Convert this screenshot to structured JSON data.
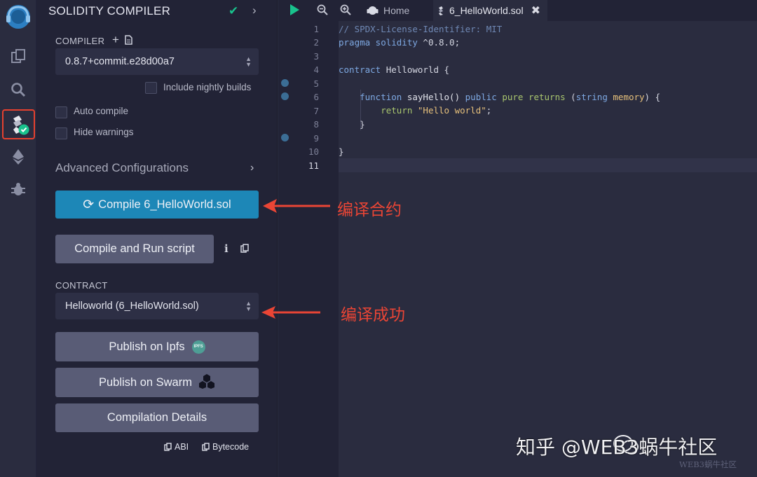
{
  "sidebar": {
    "title": "SOLIDITY COMPILER",
    "compiler_label": "COMPILER",
    "compiler_version": "0.8.7+commit.e28d00a7",
    "include_nightly": "Include nightly builds",
    "auto_compile": "Auto compile",
    "hide_warnings": "Hide warnings",
    "advanced": "Advanced Configurations",
    "compile_button": "Compile 6_HelloWorld.sol",
    "run_script_button": "Compile and Run script",
    "contract_label": "CONTRACT",
    "contract_value": "Helloworld (6_HelloWorld.sol)",
    "publish_ipfs": "Publish on Ipfs",
    "ipfs_badge": "IPFS",
    "publish_swarm": "Publish on Swarm",
    "compilation_details": "Compilation Details",
    "abi_link": "ABI",
    "bytecode_link": "Bytecode"
  },
  "tabs": {
    "home": "Home",
    "file": "6_HelloWorld.sol"
  },
  "editor": {
    "line_numbers": [
      "1",
      "2",
      "3",
      "4",
      "5",
      "6",
      "7",
      "8",
      "9",
      "10",
      "11"
    ],
    "active_line": "11",
    "line1": "// SPDX-License-Identifier: MIT",
    "line2_kw": "pragma solidity",
    "line2_rest": " ^0.8.0;",
    "line4_kw": "contract",
    "line4_rest": " Helloworld {",
    "line6_kw1": "function",
    "line6_name": " sayHello() ",
    "line6_kw2": "public",
    "line6_pure": "pure returns",
    "line6_open": " (",
    "line6_type": "string",
    "line6_mem": "memory",
    "line6_close": ") {",
    "line7_kw": "return",
    "line7_str": "\"Hello world\"",
    "line7_end": ";",
    "line8": "}",
    "line10": "}"
  },
  "annotations": {
    "compile": "编译合约",
    "success": "编译成功"
  },
  "watermark": {
    "main": "知乎 @WEB3蜗牛社区",
    "small": "WEB3蜗牛社区"
  },
  "colors": {
    "accent": "#1d87b7",
    "annotation": "#ea4535",
    "success": "#19c38d"
  }
}
